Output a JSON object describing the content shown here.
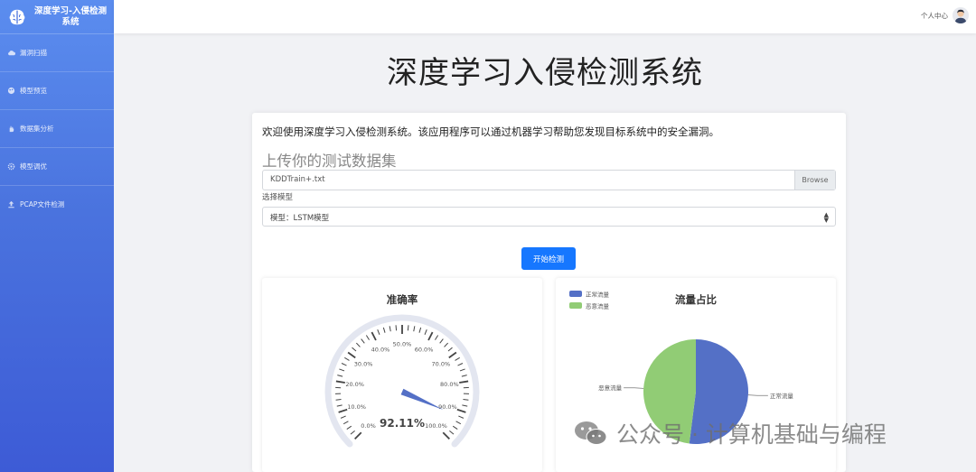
{
  "sidebar": {
    "brand_title": "深度学习-入侵检测系统",
    "items": [
      {
        "label": "漏洞扫描",
        "icon": "cloud-icon"
      },
      {
        "label": "模型预览",
        "icon": "palette-icon"
      },
      {
        "label": "数据集分析",
        "icon": "hand-icon"
      },
      {
        "label": "模型调优",
        "icon": "gear-icon"
      },
      {
        "label": "PCAP文件检测",
        "icon": "upload-icon"
      }
    ]
  },
  "topbar": {
    "user_label": "个人中心"
  },
  "main": {
    "title": "深度学习入侵检测系统",
    "intro": "欢迎使用深度学习入侵检测系统。该应用程序可以通过机器学习帮助您发现目标系统中的安全漏洞。",
    "upload_heading": "上传你的测试数据集",
    "file_name": "KDDTrain+.txt",
    "browse_label": "Browse",
    "model_label": "选择模型",
    "model_value": "模型：LSTM模型",
    "start_button": "开始检测"
  },
  "watermark": {
    "text": "公众号 · 计算机基础与编程"
  },
  "colors": {
    "accent": "#1677ff",
    "normal": "#5470c6",
    "malicious": "#91cc75",
    "gauge": "#5470c6"
  },
  "chart_data": [
    {
      "type": "gauge",
      "title": "准确率",
      "value": 92.11,
      "value_label": "92.11%",
      "min": 0,
      "max": 100,
      "tick_labels": [
        "0.0%",
        "10.0%",
        "20.0%",
        "30.0%",
        "40.0%",
        "50.0%",
        "60.0%",
        "70.0%",
        "80.0%",
        "90.0%",
        "100.0%"
      ]
    },
    {
      "type": "pie",
      "title": "流量占比",
      "legend_position": "top-left",
      "slices": [
        {
          "name": "正常流量",
          "value": 52
        },
        {
          "name": "恶意流量",
          "value": 48
        }
      ]
    }
  ]
}
